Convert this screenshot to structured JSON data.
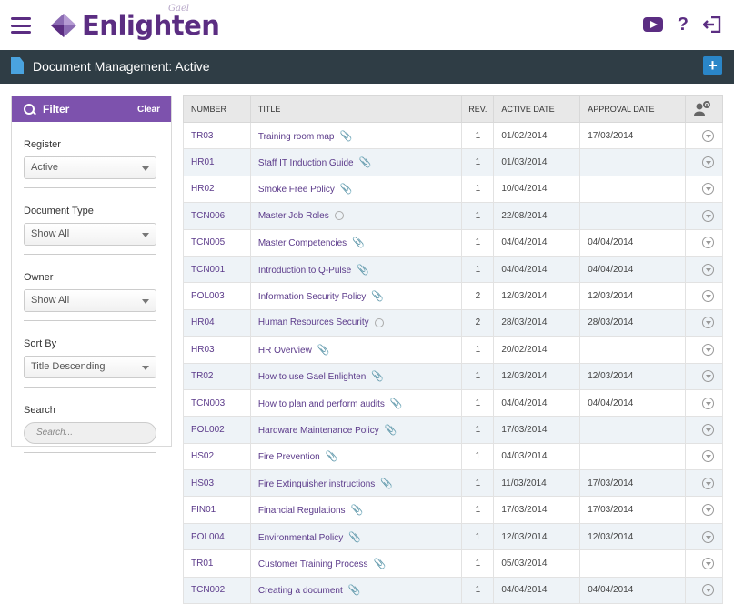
{
  "app": {
    "logo_text": "Enlighten",
    "logo_sub": "Gael"
  },
  "header": {
    "page_title": "Document Management: Active",
    "add_label": "+"
  },
  "filter": {
    "title": "Filter",
    "clear_label": "Clear",
    "register": {
      "label": "Register",
      "value": "Active"
    },
    "document_type": {
      "label": "Document Type",
      "value": "Show All"
    },
    "owner": {
      "label": "Owner",
      "value": "Show All"
    },
    "sort_by": {
      "label": "Sort By",
      "value": "Title Descending"
    },
    "search": {
      "label": "Search",
      "placeholder": "Search..."
    }
  },
  "table": {
    "columns": [
      "NUMBER",
      "TITLE",
      "REV.",
      "ACTIVE DATE",
      "APPROVAL DATE"
    ],
    "rows": [
      {
        "number": "TR03",
        "title": "Training room map",
        "attach": "clip",
        "rev": "1",
        "active": "01/02/2014",
        "approval": "17/03/2014"
      },
      {
        "number": "HR01",
        "title": "Staff IT Induction Guide",
        "attach": "clip",
        "rev": "1",
        "active": "01/03/2014",
        "approval": ""
      },
      {
        "number": "HR02",
        "title": "Smoke Free Policy",
        "attach": "clip",
        "rev": "1",
        "active": "10/04/2014",
        "approval": ""
      },
      {
        "number": "TCN006",
        "title": "Master Job Roles",
        "attach": "globe",
        "rev": "1",
        "active": "22/08/2014",
        "approval": ""
      },
      {
        "number": "TCN005",
        "title": "Master Competencies",
        "attach": "clip",
        "rev": "1",
        "active": "04/04/2014",
        "approval": "04/04/2014"
      },
      {
        "number": "TCN001",
        "title": "Introduction to Q-Pulse",
        "attach": "clip",
        "rev": "1",
        "active": "04/04/2014",
        "approval": "04/04/2014"
      },
      {
        "number": "POL003",
        "title": "Information Security Policy",
        "attach": "clip",
        "rev": "2",
        "active": "12/03/2014",
        "approval": "12/03/2014"
      },
      {
        "number": "HR04",
        "title": "Human Resources Security",
        "attach": "globe",
        "rev": "2",
        "active": "28/03/2014",
        "approval": "28/03/2014"
      },
      {
        "number": "HR03",
        "title": "HR Overview",
        "attach": "clip",
        "rev": "1",
        "active": "20/02/2014",
        "approval": ""
      },
      {
        "number": "TR02",
        "title": "How to use Gael Enlighten",
        "attach": "clip",
        "rev": "1",
        "active": "12/03/2014",
        "approval": "12/03/2014"
      },
      {
        "number": "TCN003",
        "title": "How to plan and perform audits",
        "attach": "clip",
        "rev": "1",
        "active": "04/04/2014",
        "approval": "04/04/2014"
      },
      {
        "number": "POL002",
        "title": "Hardware Maintenance Policy",
        "attach": "clip",
        "rev": "1",
        "active": "17/03/2014",
        "approval": ""
      },
      {
        "number": "HS02",
        "title": "Fire Prevention",
        "attach": "clip",
        "rev": "1",
        "active": "04/03/2014",
        "approval": ""
      },
      {
        "number": "HS03",
        "title": "Fire Extinguisher instructions",
        "attach": "clip",
        "rev": "1",
        "active": "11/03/2014",
        "approval": "17/03/2014"
      },
      {
        "number": "FIN01",
        "title": "Financial Regulations",
        "attach": "clip",
        "rev": "1",
        "active": "17/03/2014",
        "approval": "17/03/2014"
      },
      {
        "number": "POL004",
        "title": "Environmental Policy",
        "attach": "clip",
        "rev": "1",
        "active": "12/03/2014",
        "approval": "12/03/2014"
      },
      {
        "number": "TR01",
        "title": "Customer Training Process",
        "attach": "clip",
        "rev": "1",
        "active": "05/03/2014",
        "approval": ""
      },
      {
        "number": "TCN002",
        "title": "Creating a document",
        "attach": "clip",
        "rev": "1",
        "active": "04/04/2014",
        "approval": "04/04/2014"
      }
    ]
  },
  "colors": {
    "brand": "#5b2d82",
    "titlebar": "#2f3d45",
    "filter_head": "#7d52ad",
    "add_button": "#2a86c8"
  },
  "icons": [
    "menu-icon",
    "youtube-icon",
    "help-icon",
    "logout-icon",
    "document-icon",
    "add-icon",
    "search-icon",
    "user-settings-icon",
    "attachment-icon",
    "globe-icon",
    "row-options-icon"
  ]
}
